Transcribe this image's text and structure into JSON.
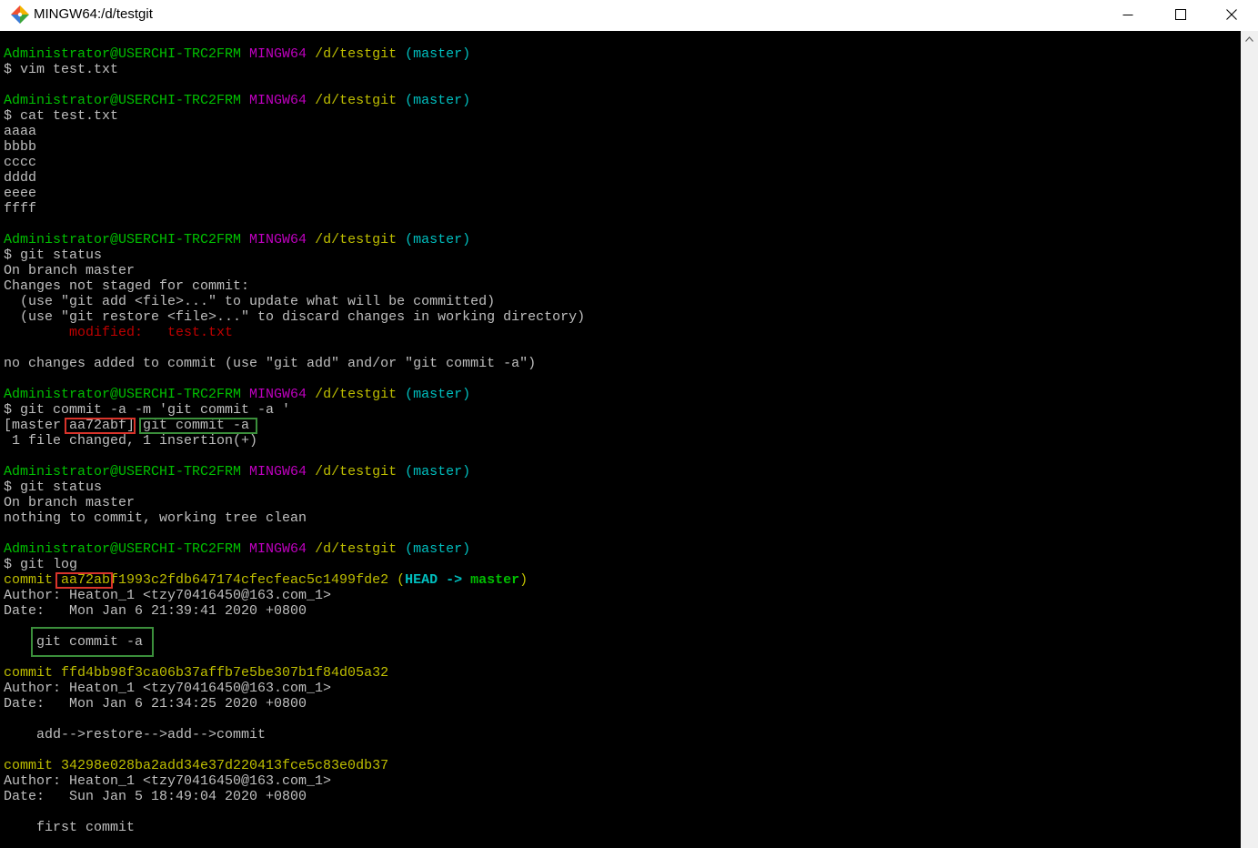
{
  "window": {
    "title": "MINGW64:/d/testgit"
  },
  "icons": {
    "app": "git-bash-icon",
    "minimize": "minimize-icon",
    "maximize": "maximize-icon",
    "close": "close-icon",
    "scroll_up": "chevron-up-icon"
  },
  "colors": {
    "background": "#000000",
    "default": "#bfbfbf",
    "green": "#00bf00",
    "magenta": "#bf00bf",
    "yellow": "#bfbf00",
    "cyan": "#00bfbf",
    "red": "#bf0000",
    "box_red": "#d9342b",
    "box_green": "#3b8f3b"
  },
  "terminal": {
    "lines": [
      [
        {
          "text": "Administrator@USERCHI-TRC2FRM",
          "color": "green"
        },
        {
          "text": " MINGW64",
          "color": "magenta"
        },
        {
          "text": " /d/testgit",
          "color": "yellow"
        },
        {
          "text": " (master)",
          "color": "cyan"
        }
      ],
      [
        {
          "text": "$ vim test.txt",
          "color": "default"
        }
      ],
      [],
      [
        {
          "text": "Administrator@USERCHI-TRC2FRM",
          "color": "green"
        },
        {
          "text": " MINGW64",
          "color": "magenta"
        },
        {
          "text": " /d/testgit",
          "color": "yellow"
        },
        {
          "text": " (master)",
          "color": "cyan"
        }
      ],
      [
        {
          "text": "$ cat test.txt",
          "color": "default"
        }
      ],
      [
        {
          "text": "aaaa",
          "color": "default"
        }
      ],
      [
        {
          "text": "bbbb",
          "color": "default"
        }
      ],
      [
        {
          "text": "cccc",
          "color": "default"
        }
      ],
      [
        {
          "text": "dddd",
          "color": "default"
        }
      ],
      [
        {
          "text": "eeee",
          "color": "default"
        }
      ],
      [
        {
          "text": "ffff",
          "color": "default"
        }
      ],
      [],
      [
        {
          "text": "Administrator@USERCHI-TRC2FRM",
          "color": "green"
        },
        {
          "text": " MINGW64",
          "color": "magenta"
        },
        {
          "text": " /d/testgit",
          "color": "yellow"
        },
        {
          "text": " (master)",
          "color": "cyan"
        }
      ],
      [
        {
          "text": "$ git status",
          "color": "default"
        }
      ],
      [
        {
          "text": "On branch master",
          "color": "default"
        }
      ],
      [
        {
          "text": "Changes not staged for commit:",
          "color": "default"
        }
      ],
      [
        {
          "text": "  (use \"git add <file>...\" to update what will be committed)",
          "color": "default"
        }
      ],
      [
        {
          "text": "  (use \"git restore <file>...\" to discard changes in working directory)",
          "color": "default"
        }
      ],
      [
        {
          "text": "        ",
          "color": "default"
        },
        {
          "text": "modified:   test.txt",
          "color": "red"
        }
      ],
      [],
      [
        {
          "text": "no changes added to commit (use \"git add\" and/or \"git commit -a\")",
          "color": "default"
        }
      ],
      [],
      [
        {
          "text": "Administrator@USERCHI-TRC2FRM",
          "color": "green"
        },
        {
          "text": " MINGW64",
          "color": "magenta"
        },
        {
          "text": " /d/testgit",
          "color": "yellow"
        },
        {
          "text": " (master)",
          "color": "cyan"
        }
      ],
      [
        {
          "text": "$ git commit -a -m 'git commit -a '",
          "color": "default"
        }
      ],
      [
        {
          "text": "[master aa72abf] git commit -a",
          "color": "default"
        }
      ],
      [
        {
          "text": " 1 file changed, 1 insertion(+)",
          "color": "default"
        }
      ],
      [],
      [
        {
          "text": "Administrator@USERCHI-TRC2FRM",
          "color": "green"
        },
        {
          "text": " MINGW64",
          "color": "magenta"
        },
        {
          "text": " /d/testgit",
          "color": "yellow"
        },
        {
          "text": " (master)",
          "color": "cyan"
        }
      ],
      [
        {
          "text": "$ git status",
          "color": "default"
        }
      ],
      [
        {
          "text": "On branch master",
          "color": "default"
        }
      ],
      [
        {
          "text": "nothing to commit, working tree clean",
          "color": "default"
        }
      ],
      [],
      [
        {
          "text": "Administrator@USERCHI-TRC2FRM",
          "color": "green"
        },
        {
          "text": " MINGW64",
          "color": "magenta"
        },
        {
          "text": " /d/testgit",
          "color": "yellow"
        },
        {
          "text": " (master)",
          "color": "cyan"
        }
      ],
      [
        {
          "text": "$ git log",
          "color": "default"
        }
      ],
      [
        {
          "text": "commit aa72abf1993c2fdb647174cfecfeac5c1499fde2 (",
          "color": "yellow"
        },
        {
          "text": "HEAD -> ",
          "color": "cyan",
          "bold": true
        },
        {
          "text": "master",
          "color": "green",
          "bold": true
        },
        {
          "text": ")",
          "color": "yellow"
        }
      ],
      [
        {
          "text": "Author: Heaton_1 <tzy70416450@163.com_1>",
          "color": "default"
        }
      ],
      [
        {
          "text": "Date:   Mon Jan 6 21:39:41 2020 +0800",
          "color": "default"
        }
      ],
      [],
      [
        {
          "text": "    git commit -a",
          "color": "default"
        }
      ],
      [],
      [
        {
          "text": "commit ffd4bb98f3ca06b37affb7e5be307b1f84d05a32",
          "color": "yellow"
        }
      ],
      [
        {
          "text": "Author: Heaton_1 <tzy70416450@163.com_1>",
          "color": "default"
        }
      ],
      [
        {
          "text": "Date:   Mon Jan 6 21:34:25 2020 +0800",
          "color": "default"
        }
      ],
      [],
      [
        {
          "text": "    add-->restore-->add-->commit",
          "color": "default"
        }
      ],
      [],
      [
        {
          "text": "commit 34298e028ba2add34e37d220413fce5c83e0db37",
          "color": "yellow"
        }
      ],
      [
        {
          "text": "Author: Heaton_1 <tzy70416450@163.com_1>",
          "color": "default"
        }
      ],
      [
        {
          "text": "Date:   Sun Jan 5 18:49:04 2020 +0800",
          "color": "default"
        }
      ],
      [],
      [
        {
          "text": "    first commit",
          "color": "default"
        }
      ]
    ]
  }
}
